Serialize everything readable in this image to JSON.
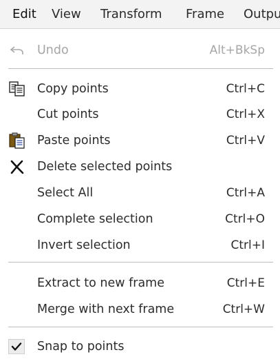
{
  "menubar": {
    "items": [
      "Edit",
      "View",
      "Transform",
      "Frame",
      "Outpu"
    ]
  },
  "menu": {
    "undo": {
      "label": "Undo",
      "shortcut": "Alt+BkSp",
      "icon": "undo-icon",
      "enabled": false
    },
    "copy_points": {
      "label": "Copy points",
      "shortcut": "Ctrl+C",
      "icon": "copy-icon"
    },
    "cut_points": {
      "label": "Cut points",
      "shortcut": "Ctrl+X"
    },
    "paste_points": {
      "label": "Paste points",
      "shortcut": "Ctrl+V",
      "icon": "paste-icon"
    },
    "delete_selected_points": {
      "label": "Delete selected points",
      "icon": "delete-x-icon"
    },
    "select_all": {
      "label": "Select All",
      "shortcut": "Ctrl+A"
    },
    "complete_selection": {
      "label": "Complete selection",
      "shortcut": "Ctrl+O"
    },
    "invert_selection": {
      "label": "Invert selection",
      "shortcut": "Ctrl+I"
    },
    "extract_to_new_frame": {
      "label": "Extract to new frame",
      "shortcut": "Ctrl+E"
    },
    "merge_with_next_frame": {
      "label": "Merge with next frame",
      "shortcut": "Ctrl+W"
    },
    "snap_to_points": {
      "label": "Snap to points",
      "checked": true,
      "icon": "checkmark-icon"
    }
  }
}
